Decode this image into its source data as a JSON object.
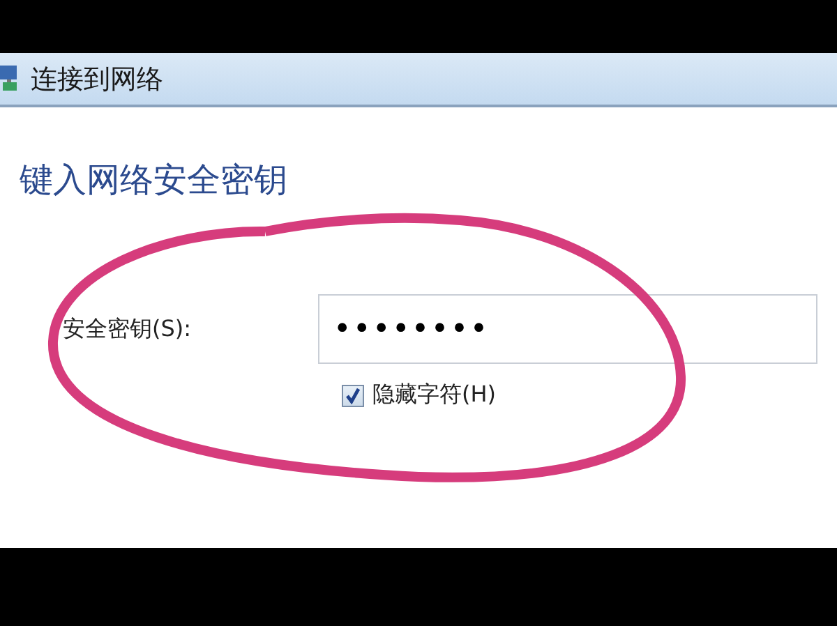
{
  "window": {
    "title": "连接到网络"
  },
  "heading": "键入网络安全密钥",
  "security_key": {
    "label": "安全密钥(S):",
    "value": "••••••••"
  },
  "hide_characters": {
    "label": "隐藏字符(H)",
    "checked": true
  }
}
